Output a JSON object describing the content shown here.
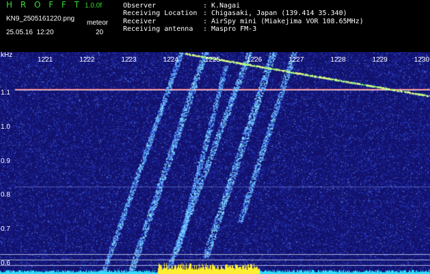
{
  "header": {
    "app_name": "H R O F F T",
    "version": "1.0.0f",
    "filename": "KN9_2505161220.png",
    "mode": "meteor",
    "datetime": "25.05.16  12:20",
    "counter": "20"
  },
  "info": [
    {
      "label": "Observer",
      "value": "K.Nagai"
    },
    {
      "label": "Receiving Location",
      "value": "Chigasaki, Japan (139.414 35.340)"
    },
    {
      "label": "Receiver",
      "value": "AirSpy mini (Miakejima VOR 108.65MHz)"
    },
    {
      "label": "Receiving antenna",
      "value": "Maspro FM-3"
    }
  ],
  "colon": ":",
  "colors": {
    "background": "#12126e",
    "noise": "#3a5cff",
    "trail": "#8ff0ff",
    "carrier": "#ff6060",
    "bottom_band": "#33ddff",
    "bottom_peak": "#ffee33",
    "text": "#ffffff",
    "brand": "#33dd33"
  },
  "chart_data": {
    "type": "heatmap",
    "title": "",
    "xlabel": "",
    "ylabel": "kHz",
    "x_ticks": [
      "1221",
      "1222",
      "1223",
      "1224",
      "1225",
      "1226",
      "1227",
      "1228",
      "1229",
      "1230"
    ],
    "y_ticks": [
      "1.1",
      "1.0",
      "0.9",
      "0.8",
      "0.7",
      "0.6"
    ],
    "ylim": [
      0.57,
      1.22
    ],
    "carrier_khz": 1.11,
    "secondary_line_khz": 0.826
  }
}
